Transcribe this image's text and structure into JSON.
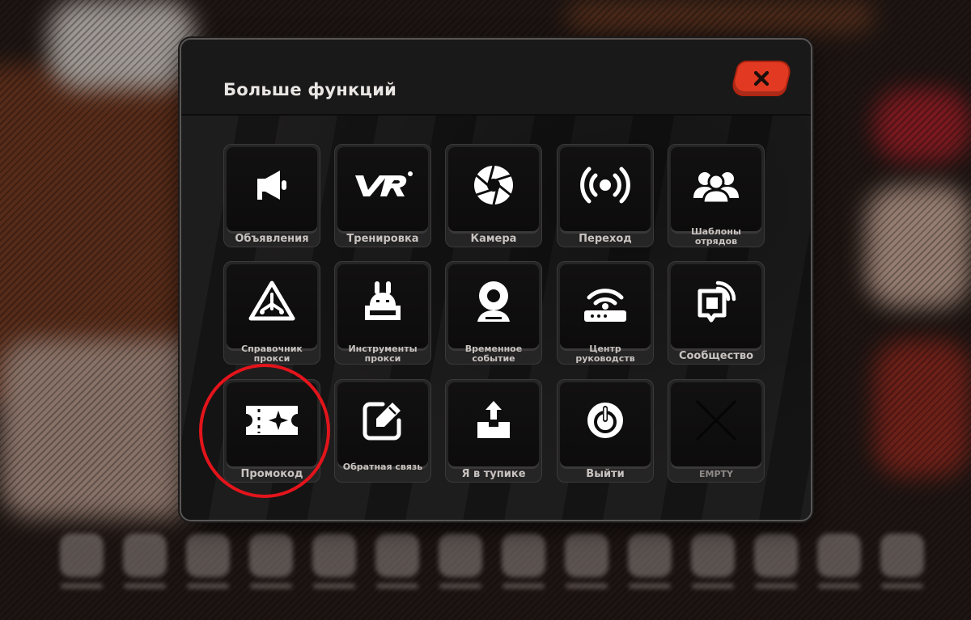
{
  "modal": {
    "title": "Больше функций",
    "close_icon": "close-icon"
  },
  "tiles": [
    {
      "label": "Объявления",
      "icon": "megaphone-icon"
    },
    {
      "label": "Тренировка",
      "icon": "vr-icon"
    },
    {
      "label": "Камера",
      "icon": "camera-aperture-icon"
    },
    {
      "label": "Переход",
      "icon": "broadcast-icon"
    },
    {
      "label": "Шаблоны отрядов",
      "icon": "squad-icon"
    },
    {
      "label": "Справочник прокси",
      "icon": "proxy-guide-icon"
    },
    {
      "label": "Инструменты прокси",
      "icon": "bunny-robot-icon"
    },
    {
      "label": "Временное событие",
      "icon": "webcam-icon"
    },
    {
      "label": "Центр руководств",
      "icon": "router-icon"
    },
    {
      "label": "Сообщество",
      "icon": "community-icon"
    },
    {
      "label": "Промокод",
      "icon": "ticket-icon"
    },
    {
      "label": "Обратная связь",
      "icon": "edit-icon"
    },
    {
      "label": "Я в тупике",
      "icon": "upload-box-icon"
    },
    {
      "label": "Выйти",
      "icon": "power-icon"
    },
    {
      "label": "EMPTY",
      "icon": "empty-x-icon"
    }
  ],
  "highlight": {
    "target": "Промокод",
    "color": "#e3141b"
  },
  "colors": {
    "accent": "#e23a22",
    "tile_face": "#0d0c0c",
    "label": "#c8c3c0"
  }
}
